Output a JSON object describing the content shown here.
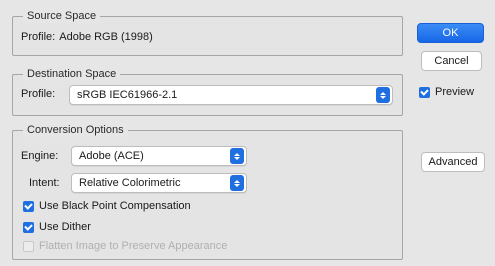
{
  "source": {
    "legend": "Source Space",
    "profile_label": "Profile:",
    "profile_value": "Adobe RGB (1998)"
  },
  "destination": {
    "legend": "Destination Space",
    "profile_label": "Profile:",
    "profile_value": "sRGB IEC61966-2.1"
  },
  "conversion": {
    "legend": "Conversion Options",
    "engine_label": "Engine:",
    "engine_value": "Adobe (ACE)",
    "intent_label": "Intent:",
    "intent_value": "Relative Colorimetric",
    "black_point": {
      "label": "Use Black Point Compensation",
      "checked": true
    },
    "dither": {
      "label": "Use Dither",
      "checked": true
    },
    "flatten": {
      "label": "Flatten Image to Preserve Appearance",
      "checked": false,
      "enabled": false
    }
  },
  "buttons": {
    "ok": "OK",
    "cancel": "Cancel",
    "advanced": "Advanced"
  },
  "preview": {
    "label": "Preview",
    "checked": true
  },
  "colors": {
    "accent": "#1f6fe0"
  }
}
